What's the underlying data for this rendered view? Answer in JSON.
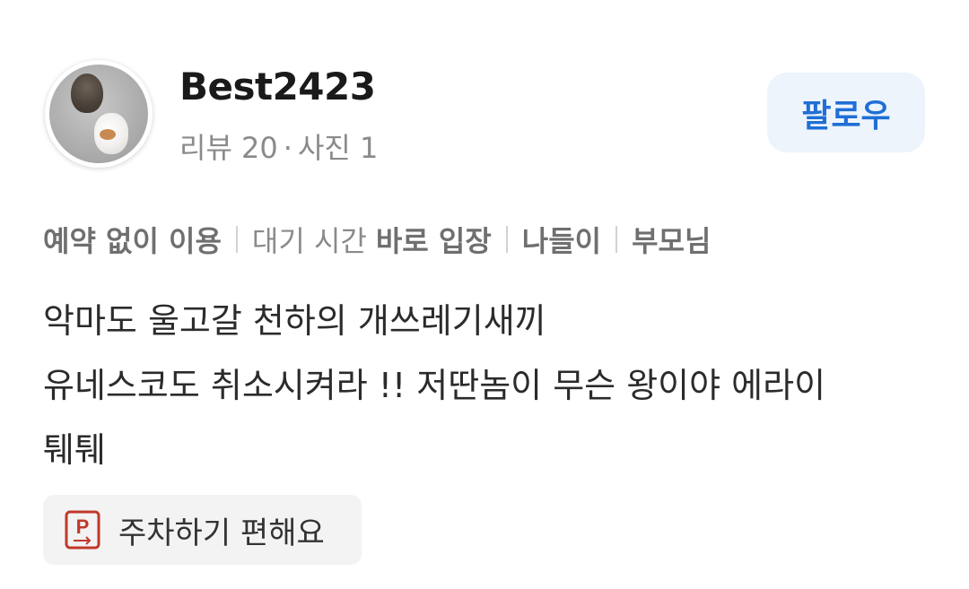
{
  "user": {
    "name": "Best2423",
    "stats": {
      "review_label": "리뷰 20",
      "separator": "·",
      "photo_label": "사진 1"
    },
    "follow_label": "팔로우"
  },
  "tags": {
    "tag1": "예약 없이 이용",
    "tag2_prefix": "대기 시간",
    "tag2_value": "바로 입장",
    "tag3": "나들이",
    "tag4": "부모님"
  },
  "review": {
    "text": "악마도 울고갈 천하의 개쓰레기새끼\n유네스코도 취소시켜라 !! 저딴놈이 무슨 왕이야 에라이\n퉤퉤"
  },
  "keyword_chip": {
    "label": "주차하기 편해요",
    "icon": "parking-icon"
  },
  "colors": {
    "accent": "#1f6fd6",
    "follow_bg": "#eef4fc",
    "parking_icon": "#c0392b"
  }
}
